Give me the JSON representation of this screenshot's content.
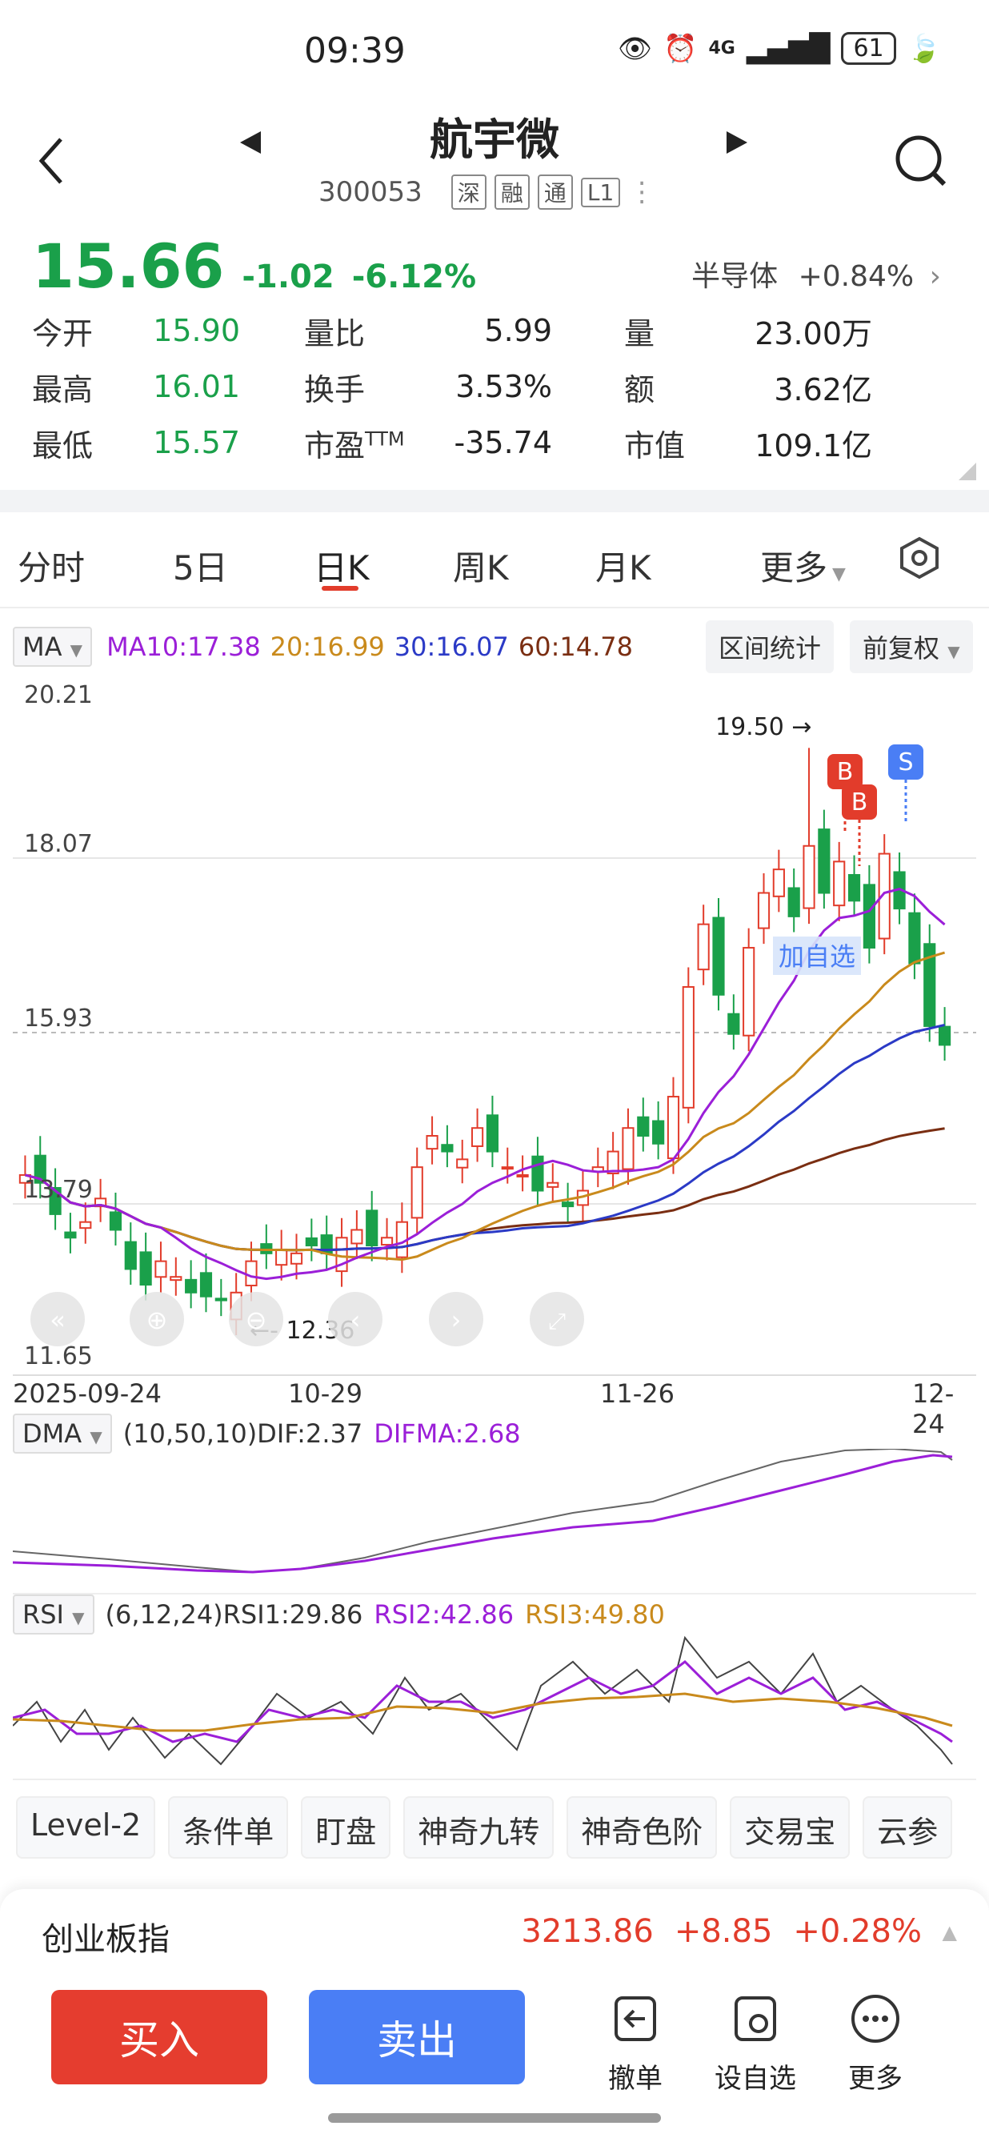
{
  "status_bar": {
    "time": "09:39",
    "battery": "61",
    "network": "4G"
  },
  "header": {
    "title": "航宇微",
    "code": "300053",
    "tags": [
      "深",
      "融",
      "通",
      "L1"
    ]
  },
  "quote": {
    "price": "15.66",
    "change": "-1.02",
    "change_pct": "-6.12%",
    "sector": "半导体",
    "sector_pct": "+0.84%",
    "rows": [
      [
        {
          "label": "今开",
          "value": "15.90"
        },
        {
          "label": "量比",
          "value": "5.99"
        },
        {
          "label": "量",
          "value": "23.00万"
        }
      ],
      [
        {
          "label": "最高",
          "value": "16.01"
        },
        {
          "label": "换手",
          "value": "3.53%"
        },
        {
          "label": "额",
          "value": "3.62亿"
        }
      ],
      [
        {
          "label": "最低",
          "value": "15.57"
        },
        {
          "label": "市盈",
          "sup": "TTM",
          "value": "-35.74"
        },
        {
          "label": "市值",
          "value": "109.1亿"
        }
      ]
    ]
  },
  "tabs": {
    "items": [
      "分时",
      "5日",
      "日K",
      "周K",
      "月K",
      "更多"
    ],
    "active": "日K"
  },
  "ma_row": {
    "selector": "MA",
    "ma10": "MA10:17.38",
    "ma20": "20:16.99",
    "ma30": "30:16.07",
    "ma60": "60:14.78",
    "range_btn": "区间统计",
    "adjust_btn": "前复权"
  },
  "chart_data": {
    "type": "candlestick",
    "y_labels": [
      "20.21",
      "18.07",
      "15.93",
      "13.79",
      "11.65"
    ],
    "x_labels": [
      "2025-09-24",
      "10-29",
      "11-26",
      "12-24"
    ],
    "annotations": {
      "high": "19.50",
      "low": "12.36",
      "tag_overlay": "加自选",
      "markers": [
        "B",
        "B",
        "S"
      ]
    },
    "colors": {
      "up": "#e23c2b",
      "down": "#1aa04a",
      "ma10": "#9b1fd8",
      "ma20": "#c98a1c",
      "ma30": "#2b3ac6",
      "ma60": "#7a2e12"
    }
  },
  "dma": {
    "selector": "DMA",
    "params": "(10,50,10)",
    "dif": "DIF:2.37",
    "difma": "DIFMA:2.68"
  },
  "rsi": {
    "selector": "RSI",
    "params": "(6,12,24)",
    "rsi1": "RSI1:29.86",
    "rsi2": "RSI2:42.86",
    "rsi3": "RSI3:49.80"
  },
  "functions": [
    "Level-2",
    "条件单",
    "盯盘",
    "神奇九转",
    "神奇色阶",
    "交易宝",
    "云参"
  ],
  "bottom": {
    "index_name": "创业板指",
    "index_value": "3213.86",
    "index_change": "+8.85",
    "index_pct": "+0.28%",
    "buy": "买入",
    "sell": "卖出",
    "actions": [
      "撤单",
      "设自选",
      "更多"
    ]
  }
}
